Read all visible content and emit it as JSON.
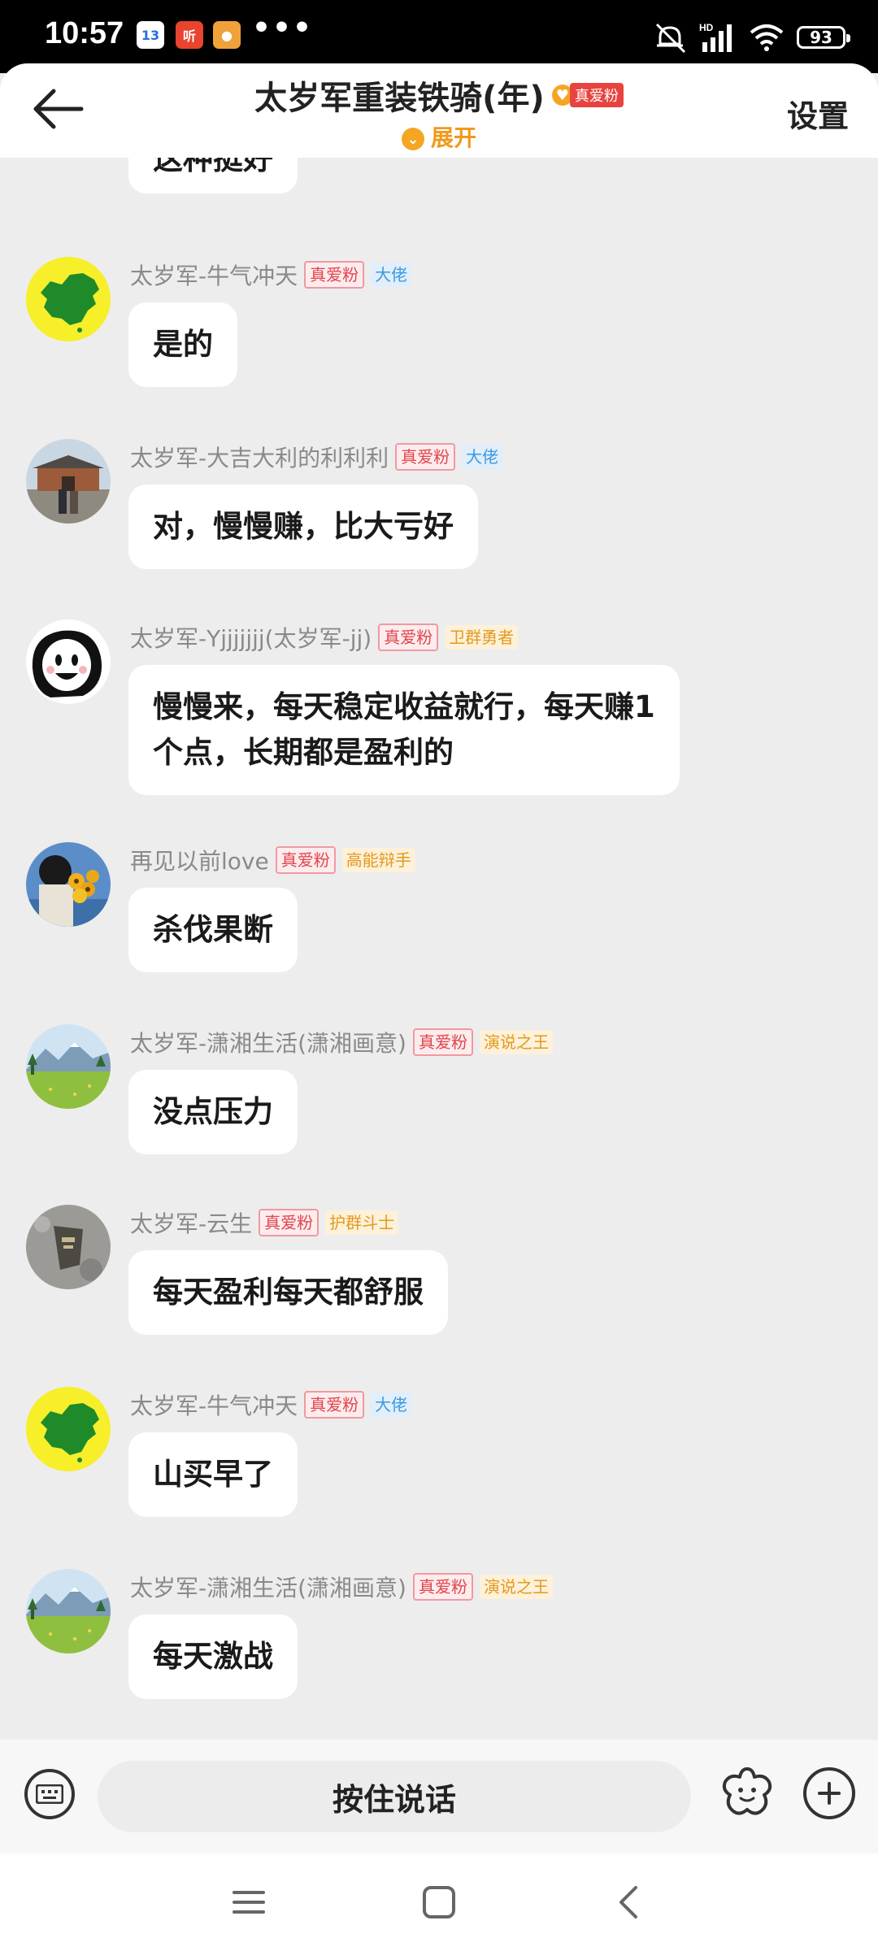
{
  "status_bar": {
    "time": "10:57",
    "app_icons": [
      {
        "name": "calendar-app-icon",
        "text": "13",
        "bg": "#ffffff",
        "fg": "#2a6edb"
      },
      {
        "name": "ting-app-icon",
        "text": "听",
        "bg": "#e8442e",
        "fg": "#ffffff"
      },
      {
        "name": "chat-app-icon",
        "text": "●",
        "bg": "#f0a23a",
        "fg": "#ffffff"
      }
    ],
    "more": "•••",
    "battery": "93"
  },
  "header": {
    "title": "太岁军重装铁骑(年)",
    "badge_label": "真爱粉",
    "expand_label": "展开",
    "settings_label": "设置"
  },
  "top_partial_bubble": "这种挺好",
  "messages": [
    {
      "name": "太岁军-牛气冲天",
      "avatar": "china-map",
      "badges": [
        {
          "text": "真爱粉",
          "style": "red"
        },
        {
          "text": "大佬",
          "style": "blue"
        }
      ],
      "text": "是的"
    },
    {
      "name": "太岁军-大吉大利的利利利",
      "avatar": "city-gate",
      "badges": [
        {
          "text": "真爱粉",
          "style": "red"
        },
        {
          "text": "大佬",
          "style": "blue"
        }
      ],
      "text": "对，慢慢赚，比大亏好"
    },
    {
      "name": "太岁军-Yjjjjjjj(太岁军-jj)",
      "avatar": "cartoon-face",
      "badges": [
        {
          "text": "真爱粉",
          "style": "red"
        },
        {
          "text": "卫群勇者",
          "style": "gold"
        }
      ],
      "text": "慢慢来，每天稳定收益就行，每天赚1\n个点，长期都是盈利的"
    },
    {
      "name": "再见以前love",
      "avatar": "flowers",
      "badges": [
        {
          "text": "真爱粉",
          "style": "red"
        },
        {
          "text": "高能辩手",
          "style": "gold"
        }
      ],
      "text": "杀伐果断"
    },
    {
      "name": "太岁军-潇湘生活(潇湘画意)",
      "avatar": "landscape",
      "badges": [
        {
          "text": "真爱粉",
          "style": "red"
        },
        {
          "text": "演说之王",
          "style": "gold"
        }
      ],
      "text": "没点压力"
    },
    {
      "name": "太岁军-云生",
      "avatar": "stone",
      "badges": [
        {
          "text": "真爱粉",
          "style": "red"
        },
        {
          "text": "护群斗士",
          "style": "gold"
        }
      ],
      "text": "每天盈利每天都舒服"
    },
    {
      "name": "太岁军-牛气冲天",
      "avatar": "china-map",
      "badges": [
        {
          "text": "真爱粉",
          "style": "red"
        },
        {
          "text": "大佬",
          "style": "blue"
        }
      ],
      "text": "山买早了"
    },
    {
      "name": "太岁军-潇湘生活(潇湘画意)",
      "avatar": "landscape",
      "badges": [
        {
          "text": "真爱粉",
          "style": "red"
        },
        {
          "text": "演说之王",
          "style": "gold"
        }
      ],
      "text": "每天激战"
    }
  ],
  "input_bar": {
    "voice_label": "按住说话"
  },
  "colors": {
    "accent_orange": "#f5a524",
    "badge_red": "#e0454b",
    "badge_blue": "#3a9adf",
    "badge_gold": "#e39a1c",
    "background": "#ededed"
  }
}
